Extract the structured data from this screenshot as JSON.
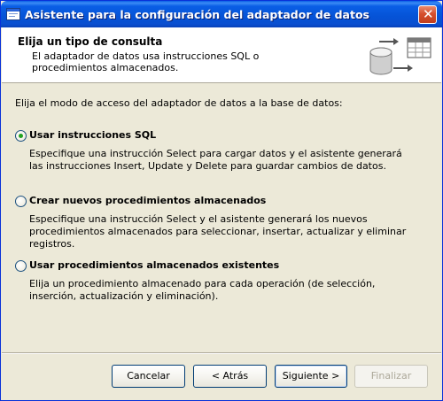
{
  "window": {
    "title": "Asistente para la configuración del adaptador de datos",
    "close_glyph": "✕"
  },
  "header": {
    "title": "Elija un tipo de consulta",
    "description": "El adaptador de datos usa instrucciones SQL o procedimientos almacenados.",
    "graphic_icon": "database-table-icon"
  },
  "body": {
    "intro": "Elija el modo de acceso del adaptador de datos a la base de datos:",
    "options": [
      {
        "label": "Usar instrucciones SQL",
        "description": "Especifique una instrucción Select para cargar datos y el asistente generará las instrucciones Insert, Update y Delete para guardar cambios de datos.",
        "selected": true
      },
      {
        "label": "Crear nuevos procedimientos almacenados",
        "description": "Especifique una instrucción Select y el asistente generará los nuevos procedimientos almacenados para seleccionar, insertar, actualizar y eliminar registros.",
        "selected": false
      },
      {
        "label": "Usar procedimientos almacenados existentes",
        "description": "Elija un procedimiento almacenado para cada operación (de selección, inserción, actualización y eliminación).",
        "selected": false
      }
    ]
  },
  "buttons": {
    "cancel": "Cancelar",
    "back": "< Atrás",
    "next": "Siguiente >",
    "finish": "Finalizar"
  },
  "colors": {
    "titlebar": "#0a5ee6",
    "selected_radio": "#21a121",
    "disabled_text": "#aca899"
  }
}
